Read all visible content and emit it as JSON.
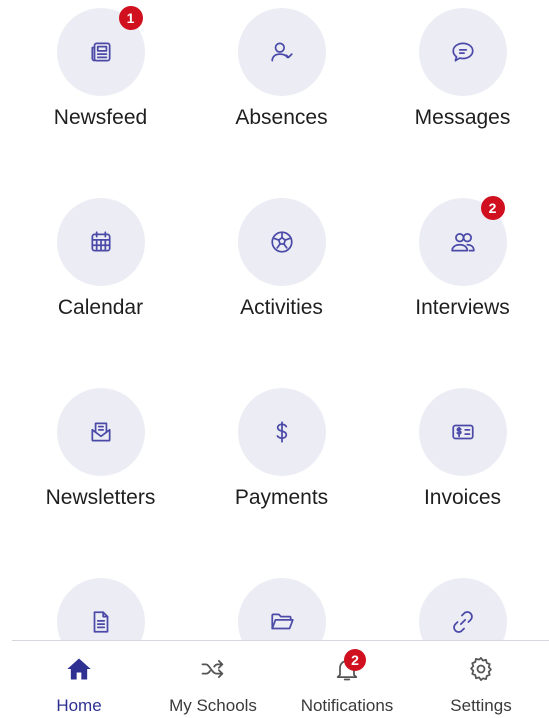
{
  "tiles": [
    {
      "label": "Newsfeed",
      "icon": "newspaper-icon",
      "badge": "1"
    },
    {
      "label": "Absences",
      "icon": "user-check-icon",
      "badge": ""
    },
    {
      "label": "Messages",
      "icon": "message-icon",
      "badge": ""
    },
    {
      "label": "Calendar",
      "icon": "calendar-icon",
      "badge": ""
    },
    {
      "label": "Activities",
      "icon": "soccer-ball-icon",
      "badge": ""
    },
    {
      "label": "Interviews",
      "icon": "users-icon",
      "badge": "2"
    },
    {
      "label": "Newsletters",
      "icon": "mail-open-icon",
      "badge": ""
    },
    {
      "label": "Payments",
      "icon": "dollar-icon",
      "badge": ""
    },
    {
      "label": "Invoices",
      "icon": "invoice-icon",
      "badge": ""
    },
    {
      "label": "",
      "icon": "document-icon",
      "badge": ""
    },
    {
      "label": "",
      "icon": "folder-open-icon",
      "badge": ""
    },
    {
      "label": "",
      "icon": "link-icon",
      "badge": ""
    }
  ],
  "tabs": [
    {
      "label": "Home",
      "icon": "home-icon",
      "active": true
    },
    {
      "label": "My Schools",
      "icon": "shuffle-icon",
      "active": false
    },
    {
      "label": "Notifications",
      "icon": "bell-icon",
      "active": false,
      "badge": "2"
    },
    {
      "label": "Settings",
      "icon": "gear-icon",
      "active": false
    }
  ],
  "colors": {
    "accent": "#4b4aa8",
    "tile_bg": "#ececf4",
    "badge": "#d0101f",
    "active_tab": "#2f3192"
  }
}
